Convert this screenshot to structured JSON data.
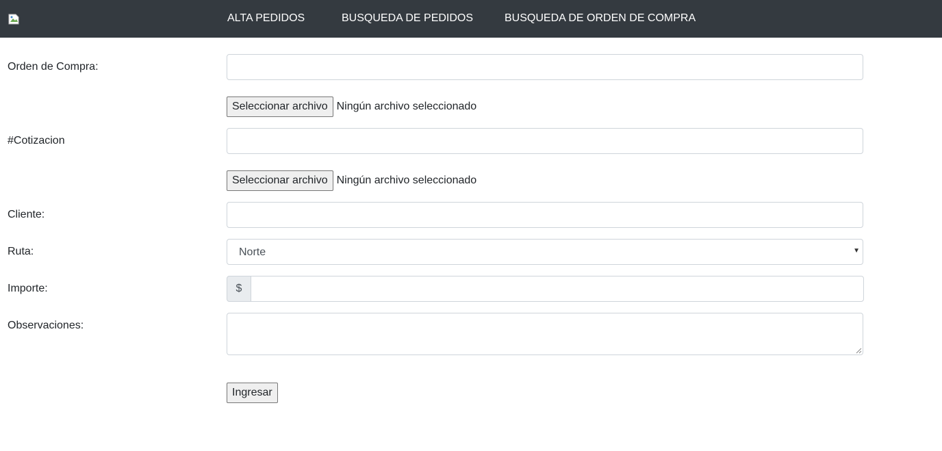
{
  "navbar": {
    "logo_icon": "broken-image-icon",
    "links": [
      "ALTA PEDIDOS",
      "BUSQUEDA DE PEDIDOS",
      "BUSQUEDA DE ORDEN DE COMPRA"
    ]
  },
  "form": {
    "orden_compra": {
      "label": "Orden de Compra:",
      "value": ""
    },
    "orden_compra_file": {
      "button": "Seleccionar archivo",
      "status": "Ningún archivo seleccionado"
    },
    "cotizacion": {
      "label": "#Cotizacion",
      "value": ""
    },
    "cotizacion_file": {
      "button": "Seleccionar archivo",
      "status": "Ningún archivo seleccionado"
    },
    "cliente": {
      "label": "Cliente:",
      "value": ""
    },
    "ruta": {
      "label": "Ruta:",
      "selected": "Norte"
    },
    "importe": {
      "label": "Importe:",
      "prefix": "$",
      "value": ""
    },
    "observaciones": {
      "label": "Observaciones:",
      "value": ""
    },
    "submit_label": "Ingresar"
  },
  "colors": {
    "navbar_bg": "#343a40",
    "navbar_text": "#ffffff",
    "input_border": "#ced4da",
    "addon_bg": "#e9ecef"
  }
}
